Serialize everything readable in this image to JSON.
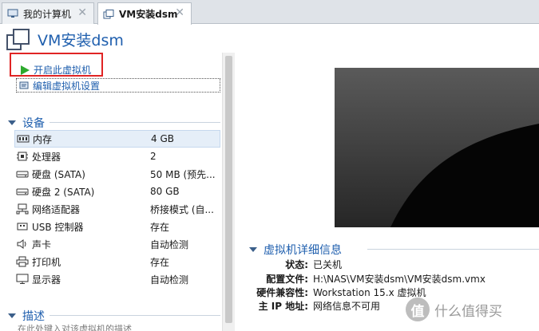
{
  "tabs": [
    {
      "label": "我的计算机",
      "icon": "computer-icon",
      "active": false
    },
    {
      "label": "VM安装dsm",
      "icon": "vm-tab-icon",
      "active": true
    }
  ],
  "header": {
    "title": "VM安装dsm",
    "icon": "vm-icon"
  },
  "actions": {
    "power_on": "开启此虚拟机",
    "edit_settings": "编辑虚拟机设置"
  },
  "devices": {
    "heading": "设备",
    "items": [
      {
        "name": "内存",
        "value": "4 GB",
        "icon": "memory-icon"
      },
      {
        "name": "处理器",
        "value": "2",
        "icon": "cpu-icon"
      },
      {
        "name": "硬盘 (SATA)",
        "value": "50 MB (预先...",
        "icon": "hard-disk-icon"
      },
      {
        "name": "硬盘 2 (SATA)",
        "value": "80 GB",
        "icon": "hard-disk-icon"
      },
      {
        "name": "网络适配器",
        "value": "桥接模式 (自...",
        "icon": "network-adapter-icon"
      },
      {
        "name": "USB 控制器",
        "value": "存在",
        "icon": "usb-icon"
      },
      {
        "name": "声卡",
        "value": "自动检测",
        "icon": "sound-card-icon"
      },
      {
        "name": "打印机",
        "value": "存在",
        "icon": "printer-icon"
      },
      {
        "name": "显示器",
        "value": "自动检测",
        "icon": "display-icon"
      }
    ]
  },
  "description": {
    "heading": "描述",
    "placeholder": "在此处键入对该虚拟机的描述"
  },
  "details": {
    "heading": "虚拟机详细信息",
    "rows": [
      {
        "label": "状态:",
        "value": "已关机"
      },
      {
        "label": "配置文件:",
        "value": "H:\\NAS\\VM安装dsm\\VM安装dsm.vmx"
      },
      {
        "label": "硬件兼容性:",
        "value": "Workstation 15.x 虚拟机"
      },
      {
        "label": "主 IP 地址:",
        "value": "网络信息不可用"
      }
    ]
  },
  "watermark": {
    "logo": "值",
    "text": "什么值得买"
  },
  "colors": {
    "accent": "#1f5fae",
    "highlight_box": "#e02424",
    "power_green": "#2eaa2e"
  }
}
